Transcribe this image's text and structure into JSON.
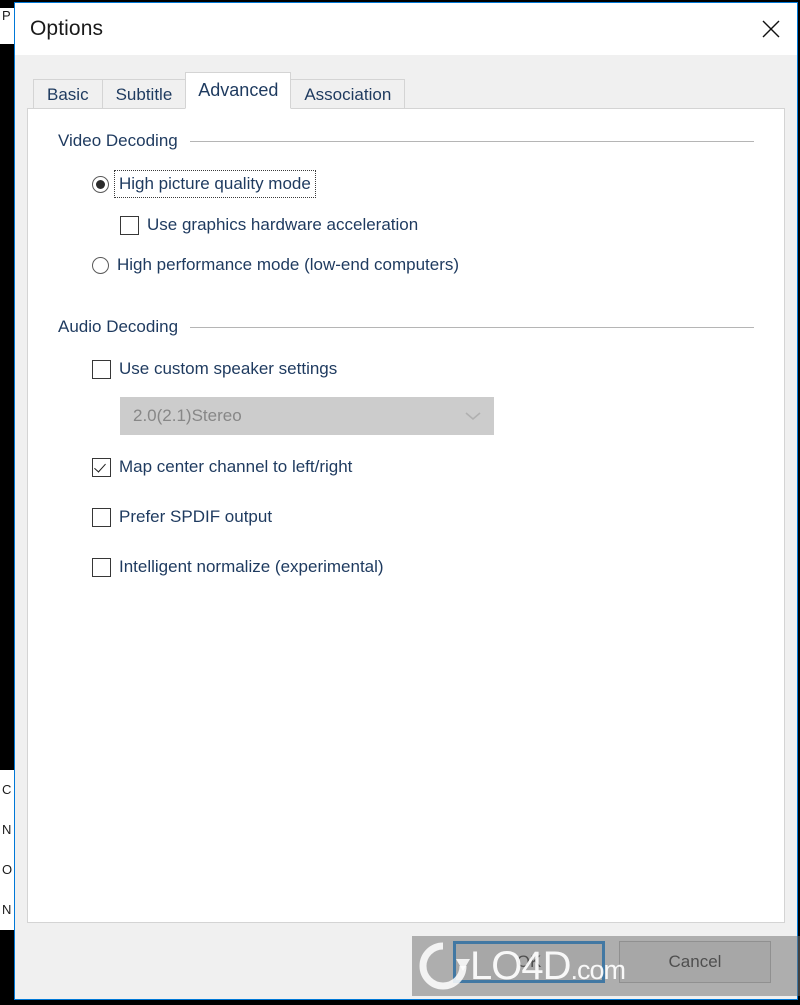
{
  "backdrop": {
    "left_top_fragment": "P",
    "left_list_fragments": [
      "C",
      "N",
      "O",
      "N"
    ]
  },
  "window": {
    "title": "Options",
    "close_icon": "close-icon",
    "accent_color": "#0078d7",
    "titlebar_bg": "#ffffff",
    "client_bg": "#f0f0f0"
  },
  "tabs": [
    {
      "label": "Basic",
      "active": false
    },
    {
      "label": "Subtitle",
      "active": false
    },
    {
      "label": "Advanced",
      "active": true
    },
    {
      "label": "Association",
      "active": false
    }
  ],
  "groups": [
    {
      "title": "Video Decoding",
      "options": [
        {
          "kind": "radio",
          "label": "High picture quality mode",
          "checked": true,
          "focused": true,
          "indent": 1,
          "name": "high-picture-quality-mode"
        },
        {
          "kind": "checkbox",
          "label": "Use graphics hardware acceleration",
          "checked": false,
          "focused": false,
          "indent": 2,
          "name": "use-graphics-hardware-acceleration"
        },
        {
          "kind": "radio",
          "label": "High performance mode (low-end computers)",
          "checked": false,
          "focused": false,
          "indent": 1,
          "name": "high-performance-mode"
        }
      ]
    },
    {
      "title": "Audio Decoding",
      "options": [
        {
          "kind": "checkbox",
          "label": "Use custom speaker settings",
          "checked": false,
          "focused": false,
          "indent": 1,
          "name": "use-custom-speaker-settings"
        },
        {
          "kind": "combobox",
          "value": "2.0(2.1)Stereo",
          "disabled": true,
          "indent": 2,
          "name": "speaker-layout-select",
          "arrow_icon": "chevron-down-icon"
        },
        {
          "kind": "checkbox",
          "label": "Map center channel to left/right",
          "checked": true,
          "focused": false,
          "indent": 1,
          "name": "map-center-channel"
        },
        {
          "kind": "checkbox",
          "label": "Prefer SPDIF output",
          "checked": false,
          "focused": false,
          "indent": 1,
          "name": "prefer-spdif-output"
        },
        {
          "kind": "checkbox",
          "label": "Intelligent normalize (experimental)",
          "checked": false,
          "focused": false,
          "indent": 1,
          "name": "intelligent-normalize"
        }
      ]
    }
  ],
  "footer": {
    "ok_label": "OK",
    "cancel_label": "Cancel",
    "default_button": "OK"
  },
  "watermark": {
    "text_main": "LO4D",
    "text_suffix": ".com",
    "logo_icon": "refresh-circle-icon"
  }
}
